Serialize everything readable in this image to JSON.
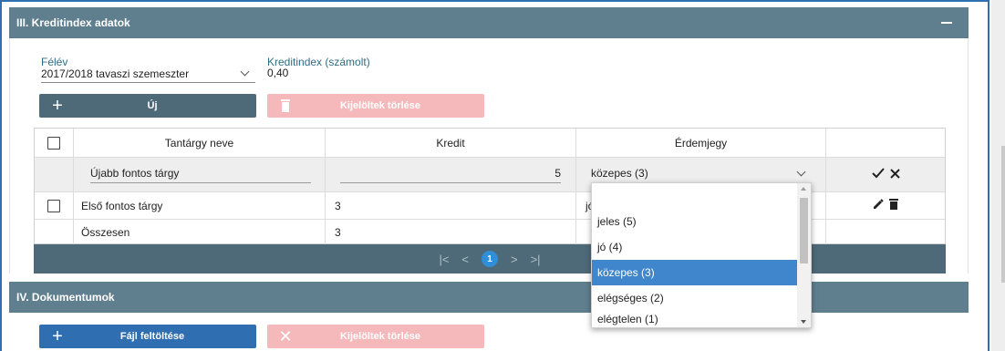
{
  "section3": {
    "title": "III. Kreditindex adatok"
  },
  "semester": {
    "label": "Félév",
    "value": "2017/2018 tavaszi szemeszter"
  },
  "credit_index": {
    "label": "Kreditindex (számolt)",
    "value": "0,40"
  },
  "buttons": {
    "new_label": "Új",
    "delete_selected_label": "Kijelöltek törlése",
    "upload_label": "Fájl feltöltése"
  },
  "table": {
    "columns": [
      "Tantárgy neve",
      "Kredit",
      "Érdemjegy"
    ],
    "edit_row": {
      "subject": "Újabb fontos tárgy",
      "credit": "5",
      "grade": "közepes (3)"
    },
    "rows": [
      {
        "subject": "Első fontos tárgy",
        "credit": "3",
        "grade_partial": "jó"
      }
    ],
    "total": {
      "label": "Összesen",
      "credit": "3"
    }
  },
  "pagination": {
    "current_page": "1"
  },
  "grade_dropdown": {
    "options": [
      "jeles (5)",
      "jó (4)",
      "közepes (3)",
      "elégséges (2)",
      "elégtelen (1)"
    ],
    "selected": "közepes (3)"
  },
  "section4": {
    "title": "IV. Dokumentumok"
  },
  "colors": {
    "header": "#5f7f8f",
    "primary": "#2f6eb0",
    "danger_disabled": "#f6b9bb",
    "pager": "#4e6a79",
    "selected_option": "#3f86cc"
  }
}
